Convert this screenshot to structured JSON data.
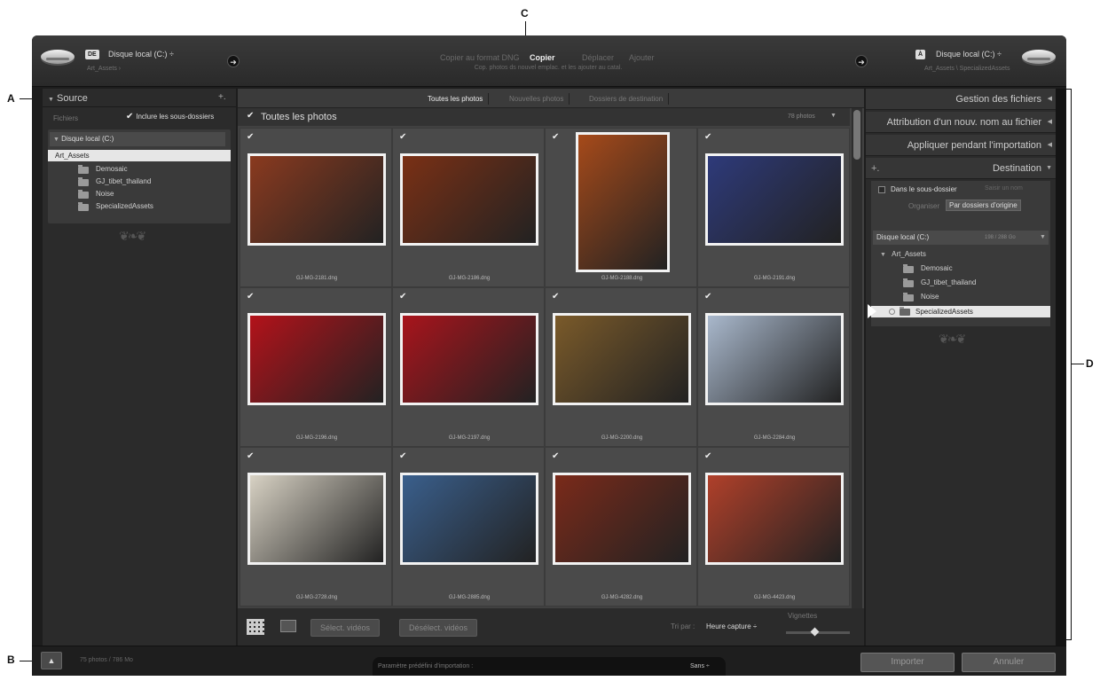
{
  "callouts": {
    "a": "A",
    "b": "B",
    "c": "C",
    "d": "D"
  },
  "header": {
    "source_badge": "DE",
    "source_drive": "Disque local (C:) ÷",
    "source_path": "Art_Assets ›",
    "dest_badge": "À",
    "dest_drive": "Disque local (C:) ÷",
    "dest_path": "Art_Assets \\ SpecializedAssets",
    "modes": [
      "Copier au format DNG",
      "Copier",
      "Déplacer",
      "Ajouter"
    ],
    "active_mode": "Copier",
    "mode_description": "Cop. photos ds nouvel emplac. et les ajouter au catal."
  },
  "source_panel": {
    "title": "Source",
    "add": "+.",
    "files_label": "Fichiers",
    "include_subfolders": "Inclure les sous-dossiers",
    "drive": "Disque local (C:)",
    "root_folder": "Art_Assets",
    "folders": [
      "Demosaic",
      "GJ_tibet_thailand",
      "Noise",
      "SpecializedAssets"
    ]
  },
  "center": {
    "tabs": [
      "Toutes les photos",
      "Nouvelles photos",
      "Dossiers de destination"
    ],
    "grid_title": "Toutes les photos",
    "grid_count": "78 photos",
    "photos": [
      {
        "name": "GJ-MG-2181.dng",
        "color": "#8a3a1f"
      },
      {
        "name": "GJ-MG-2186.dng",
        "color": "#7a3015"
      },
      {
        "name": "GJ-MG-2188.dng",
        "color": "#a64a1a"
      },
      {
        "name": "GJ-MG-2191.dng",
        "color": "#2e3a7a"
      },
      {
        "name": "GJ-MG-2196.dng",
        "color": "#b3121a"
      },
      {
        "name": "GJ-MG-2197.dng",
        "color": "#a8141c"
      },
      {
        "name": "GJ-MG-2200.dng",
        "color": "#7a5a2a"
      },
      {
        "name": "GJ-MG-2284.dng",
        "color": "#a9b8cc"
      },
      {
        "name": "GJ-MG-2728.dng",
        "color": "#d8d2c4"
      },
      {
        "name": "GJ-MG-2885.dng",
        "color": "#3a5f8c"
      },
      {
        "name": "GJ-MG-4282.dng",
        "color": "#7a2a1a"
      },
      {
        "name": "GJ-MG-4423.dng",
        "color": "#b0402a"
      }
    ],
    "select_videos": "Sélect. vidéos",
    "deselect_videos": "Désélect. vidéos",
    "sort_label": "Tri par :",
    "sort_value": "Heure capture ÷",
    "thumbnails_label": "Vignettes",
    "thumbnail_size": 0.45
  },
  "right_panel": {
    "file_handling": "Gestion des fichiers",
    "rename": "Attribution d'un nouv. nom au fichier",
    "apply": "Appliquer pendant l'importation",
    "destination": "Destination",
    "add": "+.",
    "into_subfolder": "Dans le sous-dossier",
    "subfolder_placeholder": "Saisir un nom",
    "organize_label": "Organiser",
    "organize_value": "Par dossiers d'origine",
    "drive": "Disque local (C:)",
    "drive_space": "198 / 288 Go",
    "root_folder": "Art_Assets",
    "folders": [
      "Demosaic",
      "GJ_tibet_thailand",
      "Noise",
      "SpecializedAssets"
    ]
  },
  "footer": {
    "count": "75 photos / 786 Mo",
    "preset_label": "Paramètre prédéfini d'importation :",
    "preset_value": "Sans ÷",
    "import": "Importer",
    "cancel": "Annuler"
  }
}
